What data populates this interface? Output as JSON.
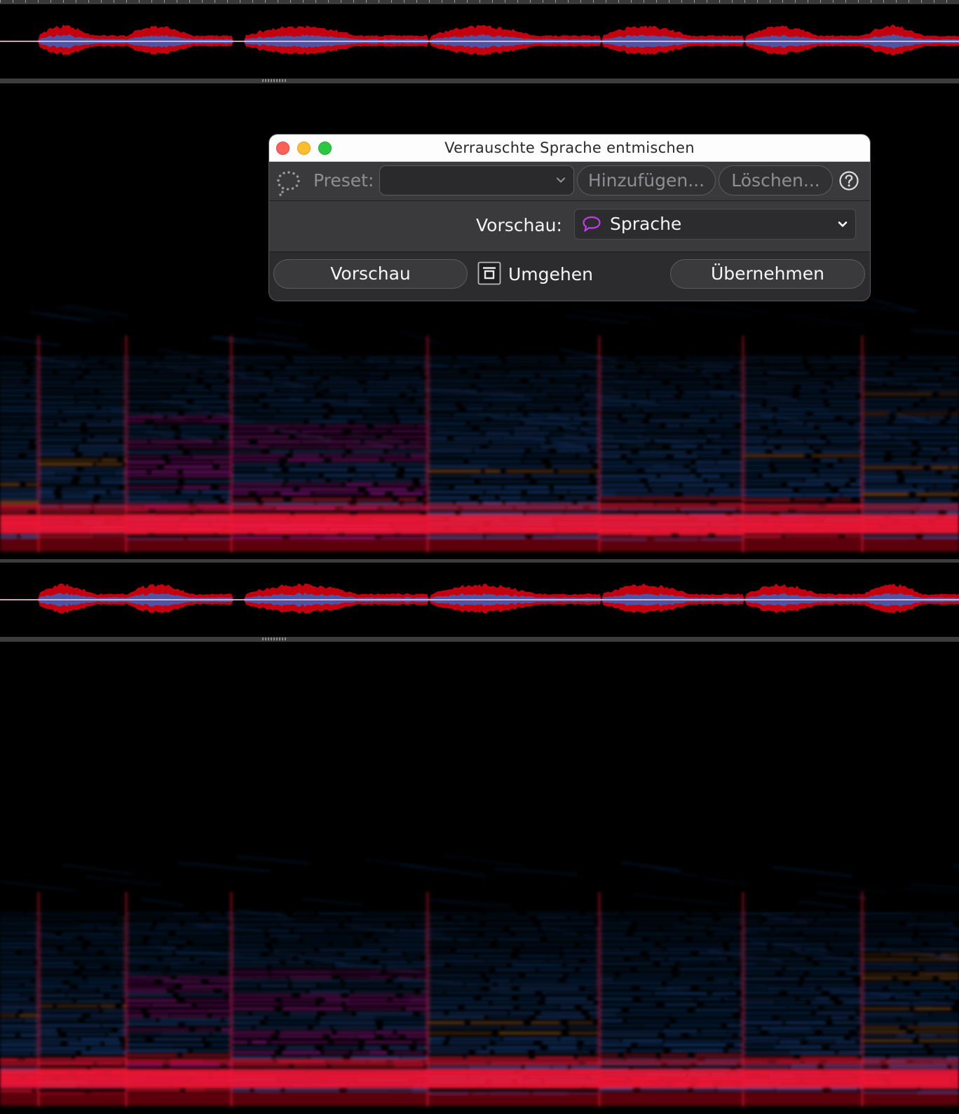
{
  "dialog": {
    "title": "Verrauschte Sprache entmischen",
    "toolbar": {
      "preset_label": "Preset:",
      "preset_value": "",
      "add_button": "Hinzufügen...",
      "delete_button": "Löschen...",
      "help_icon": "question-circle-icon",
      "preset_icon": "speech-bubble-dotted-icon"
    },
    "preview_select": {
      "label": "Vorschau:",
      "value": "Sprache",
      "icon": "speech-bubble-icon",
      "icon_color": "#c13cf0"
    },
    "buttons": {
      "preview": "Vorschau",
      "bypass": "Umgehen",
      "apply": "Übernehmen"
    }
  },
  "colors": {
    "waveform_red": "#c4000f",
    "waveform_blue": "#2a6fd6",
    "spectrogram_blue": "#1e64c8",
    "spectrogram_magenta": "#e21fd6",
    "spectrogram_red": "#ff1a3a",
    "spectrogram_orange": "#e08a2c"
  }
}
